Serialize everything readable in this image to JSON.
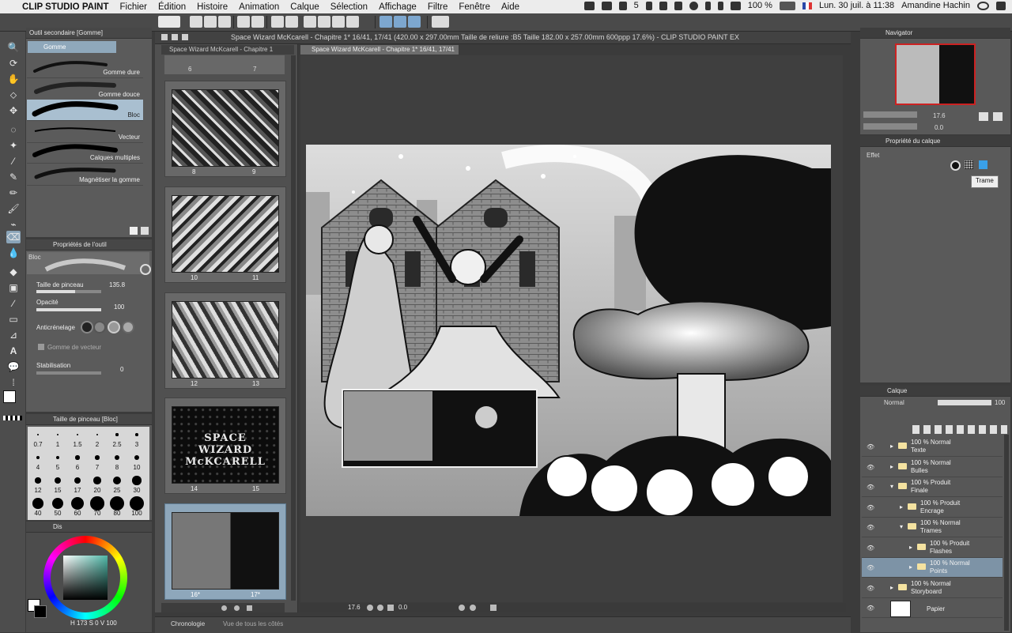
{
  "menubar": {
    "app_name": "CLIP STUDIO PAINT",
    "items": [
      "Fichier",
      "Édition",
      "Histoire",
      "Animation",
      "Calque",
      "Sélection",
      "Affichage",
      "Filtre",
      "Fenêtre",
      "Aide"
    ],
    "status_num": "5",
    "battery": "100 %",
    "datetime": "Lun. 30 juil. à 11:38",
    "user": "Amandine Hachin"
  },
  "window": {
    "title": "Space Wizard McKcarell - Chapitre 1* 16/41, 17/41 (420.00 x 297.00mm Taille de reliure :B5 Taille 182.00 x 257.00mm 600ppp 17.6%)  - CLIP STUDIO PAINT EX",
    "tabs": [
      "Space Wizard McKcarell - Chapitre 1",
      "Space Wizard McKcarell - Chapitre 1* 16/41, 17/41"
    ]
  },
  "subtool": {
    "title": "Outil secondaire [Gomme]",
    "group": "Gomme",
    "brushes": [
      "Gomme dure",
      "Gomme douce",
      "Bloc",
      "Vecteur",
      "Calques multiples",
      "Magnétiser la gomme"
    ],
    "selected": "Bloc"
  },
  "toolprops": {
    "title": "Propriétés de l'outil",
    "brush_name": "Bloc",
    "size_label": "Taille de pinceau",
    "size_value": "135.8",
    "opacity_label": "Opacité",
    "opacity_value": "100",
    "antialias_label": "Anticrénelage",
    "vector_label": "Gomme de vecteur",
    "stabilization_label": "Stabilisation",
    "stabilization_value": "0"
  },
  "brushsize": {
    "title": "Taille de pinceau [Bloc]",
    "sizes": [
      "0.7",
      "1",
      "1.5",
      "2",
      "2.5",
      "3",
      "4",
      "5",
      "6",
      "7",
      "8",
      "10",
      "12",
      "15",
      "17",
      "20",
      "25",
      "30",
      "40",
      "50",
      "60",
      "70",
      "80",
      "100"
    ]
  },
  "color": {
    "title": "Dis",
    "readout_a": "173",
    "readout_b": "0",
    "readout_c": "100"
  },
  "pages": {
    "items": [
      {
        "left": "8",
        "right": "9"
      },
      {
        "left": "10",
        "right": "11"
      },
      {
        "left": "12",
        "right": "13"
      },
      {
        "left": "14",
        "right": "15"
      },
      {
        "left": "16*",
        "right": "17*"
      }
    ],
    "top_labels": [
      "6",
      "7"
    ],
    "title_art_text": "SPACE WIZARD McKCARELL"
  },
  "canvas": {
    "zoom": "17.6",
    "angle": "0.0"
  },
  "bottom_tabs": [
    "Chronologie",
    "Vue de tous les côtés"
  ],
  "navigator": {
    "title": "Navigator",
    "zoom": "17.6",
    "angle": "0.0"
  },
  "layerprops": {
    "title": "Propriété du calque",
    "effect_label": "Effet",
    "tooltip": "Trame"
  },
  "layers": {
    "title": "Calque",
    "blend_mode": "Normal",
    "opacity": "100",
    "items": [
      {
        "line1": "100 % Normal",
        "line2": "Texte"
      },
      {
        "line1": "100 % Normal",
        "line2": "Bulles"
      },
      {
        "line1": "100 % Produit",
        "line2": "Finale"
      },
      {
        "line1": "100 % Produit",
        "line2": "Encrage"
      },
      {
        "line1": "100 % Normal",
        "line2": "Trames"
      },
      {
        "line1": "100 % Produit",
        "line2": "Flashes"
      },
      {
        "line1": "100 % Normal",
        "line2": "Points"
      },
      {
        "line1": "100 % Normal",
        "line2": "Storyboard"
      },
      {
        "line1": "",
        "line2": "Papier"
      }
    ]
  },
  "icons": [
    "apple-icon",
    "dropbox-icon",
    "cloud-icon",
    "wifi-icon",
    "battery-icon",
    "search-icon",
    "list-icon",
    "eraser-icon",
    "brush-icon",
    "pen-icon",
    "eye-icon",
    "folder-icon"
  ],
  "colors": {
    "accent": "#a9bfd0",
    "panel": "#5b5b5b",
    "layer_selected": "#7d93a6",
    "folder": "#f4e2a0"
  }
}
